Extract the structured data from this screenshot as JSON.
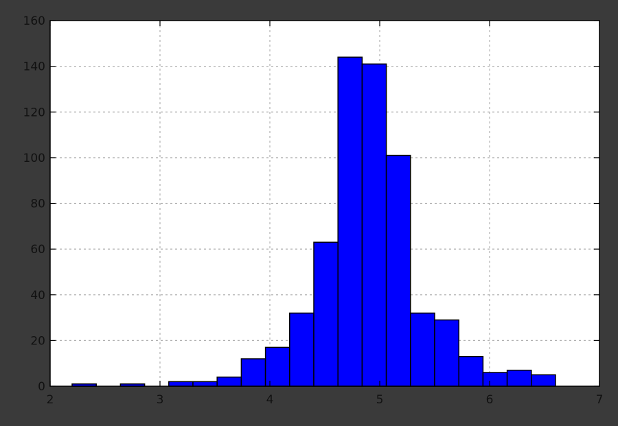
{
  "chart_data": {
    "type": "bar",
    "subtype": "histogram",
    "bins": [
      {
        "x0": 2.2,
        "x1": 2.42,
        "count": 1
      },
      {
        "x0": 2.42,
        "x1": 2.64,
        "count": 0
      },
      {
        "x0": 2.64,
        "x1": 2.86,
        "count": 1
      },
      {
        "x0": 2.86,
        "x1": 3.08,
        "count": 0
      },
      {
        "x0": 3.08,
        "x1": 3.3,
        "count": 2
      },
      {
        "x0": 3.3,
        "x1": 3.52,
        "count": 2
      },
      {
        "x0": 3.52,
        "x1": 3.74,
        "count": 4
      },
      {
        "x0": 3.74,
        "x1": 3.96,
        "count": 12
      },
      {
        "x0": 3.96,
        "x1": 4.18,
        "count": 17
      },
      {
        "x0": 4.18,
        "x1": 4.4,
        "count": 32
      },
      {
        "x0": 4.4,
        "x1": 4.62,
        "count": 63
      },
      {
        "x0": 4.62,
        "x1": 4.84,
        "count": 144
      },
      {
        "x0": 4.84,
        "x1": 5.06,
        "count": 141
      },
      {
        "x0": 5.06,
        "x1": 5.28,
        "count": 101
      },
      {
        "x0": 5.28,
        "x1": 5.5,
        "count": 32
      },
      {
        "x0": 5.5,
        "x1": 5.72,
        "count": 29
      },
      {
        "x0": 5.72,
        "x1": 5.94,
        "count": 13
      },
      {
        "x0": 5.94,
        "x1": 6.16,
        "count": 6
      },
      {
        "x0": 6.16,
        "x1": 6.38,
        "count": 7
      },
      {
        "x0": 6.38,
        "x1": 6.6,
        "count": 5
      }
    ],
    "xlim": [
      2,
      7
    ],
    "ylim": [
      0,
      160
    ],
    "xticks": [
      2,
      3,
      4,
      5,
      6,
      7
    ],
    "yticks": [
      0,
      20,
      40,
      60,
      80,
      100,
      120,
      140,
      160
    ],
    "grid": true,
    "title": "",
    "xlabel": "",
    "ylabel": "",
    "colors": {
      "bar": "#0000ff",
      "edge": "#000000",
      "background": "#ffffff",
      "frame": "#3a3a3a",
      "grid": "#b0b0b0"
    }
  }
}
